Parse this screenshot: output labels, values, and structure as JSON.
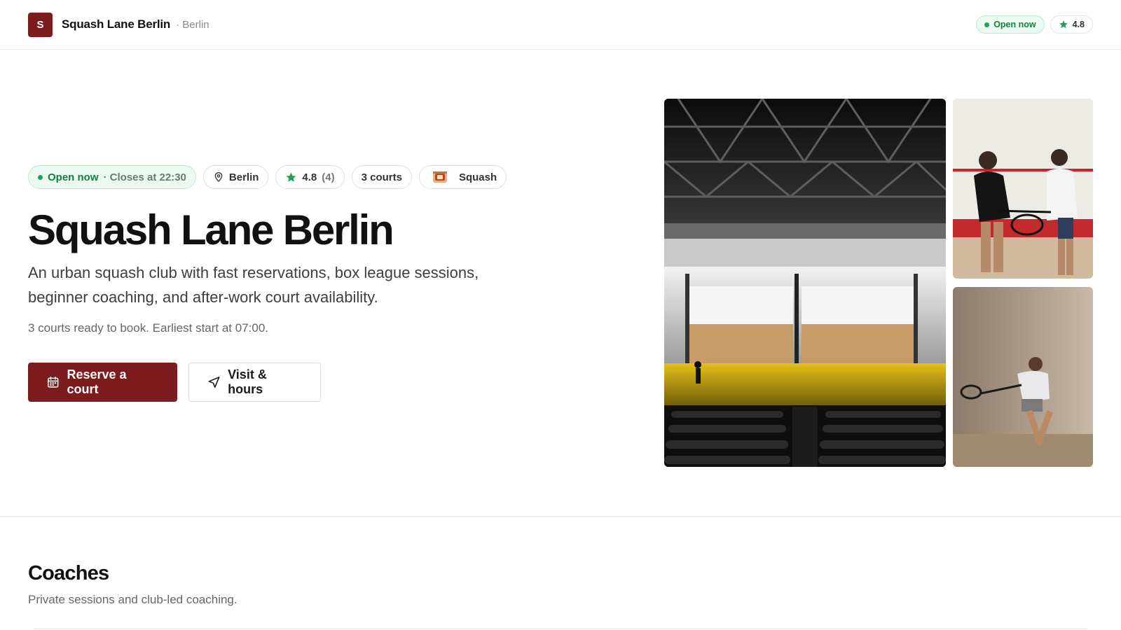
{
  "header": {
    "logo_letter": "S",
    "brand_name": "Squash Lane Berlin",
    "brand_city": "· Berlin",
    "status": "Open now",
    "rating": "4.8"
  },
  "hero": {
    "chips": {
      "open": "Open now",
      "closes": "· Closes at 22:30",
      "location": "Berlin",
      "rating": "4.8",
      "rating_count": "(4)",
      "courts": "3 courts",
      "sport": "Squash"
    },
    "title": "Squash Lane Berlin",
    "description": "An urban squash club with fast reservations, box league sessions, beginner coaching, and after-work court availability.",
    "subline": "3 courts ready to book. Earliest start at 07:00.",
    "primary_button": "Reserve a court",
    "secondary_button": "Visit & hours"
  },
  "gallery": {
    "images": [
      "squash-arena-photo",
      "players-handshake-photo",
      "player-lunge-photo"
    ]
  },
  "coaches": {
    "title": "Coaches",
    "subtitle": "Private sessions and club-led coaching."
  },
  "colors": {
    "brand": "#7c1c1c",
    "open_green": "#14803f",
    "star_green": "#1fa35a"
  }
}
